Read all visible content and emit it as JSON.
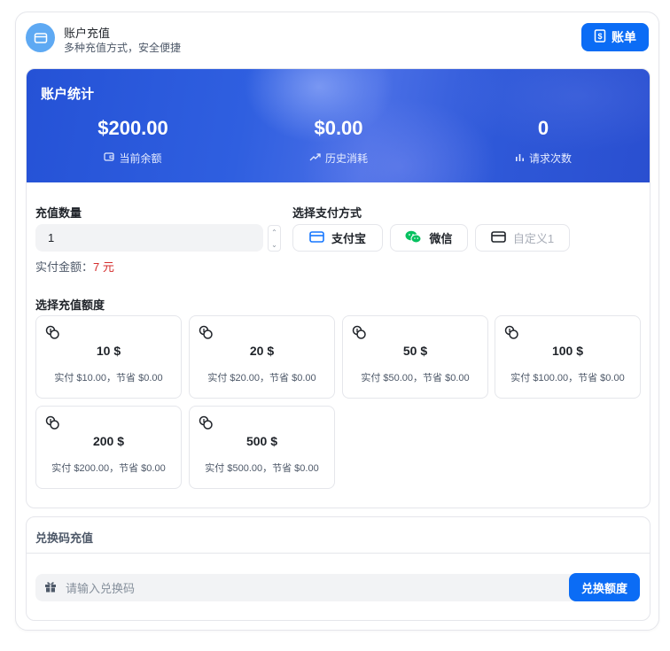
{
  "header": {
    "title": "账户充值",
    "subtitle": "多种充值方式，安全便捷",
    "bill_button": "账单"
  },
  "stats": {
    "title": "账户统计",
    "items": [
      {
        "value": "$200.00",
        "label": "当前余额",
        "icon": "wallet-icon"
      },
      {
        "value": "$0.00",
        "label": "历史消耗",
        "icon": "trend-up-icon"
      },
      {
        "value": "0",
        "label": "请求次数",
        "icon": "bar-chart-icon"
      }
    ]
  },
  "quantity": {
    "label": "充值数量",
    "value": "1",
    "pay_amount_label": "实付金额：",
    "pay_amount_value": "7 元"
  },
  "payment": {
    "label": "选择支付方式",
    "methods": [
      {
        "label": "支付宝",
        "icon": "card-icon",
        "color": "#1677ff"
      },
      {
        "label": "微信",
        "icon": "wechat-icon",
        "color": "#07c160"
      },
      {
        "label": "自定义1",
        "icon": "card-icon",
        "color": "#1f2329"
      }
    ]
  },
  "amounts": {
    "label": "选择充值额度",
    "tiles": [
      {
        "amount": "10 $",
        "note": "实付 $10.00，节省 $0.00"
      },
      {
        "amount": "20 $",
        "note": "实付 $20.00，节省 $0.00"
      },
      {
        "amount": "50 $",
        "note": "实付 $50.00，节省 $0.00"
      },
      {
        "amount": "100 $",
        "note": "实付 $100.00，节省 $0.00"
      },
      {
        "amount": "200 $",
        "note": "实付 $200.00，节省 $0.00"
      },
      {
        "amount": "500 $",
        "note": "实付 $500.00，节省 $0.00"
      }
    ]
  },
  "redeem": {
    "title": "兑换码充值",
    "placeholder": "请输入兑换码",
    "button": "兑换额度"
  },
  "colors": {
    "primary": "#0b6cf5",
    "price": "#d42c2c",
    "banner": "#2552d6"
  }
}
